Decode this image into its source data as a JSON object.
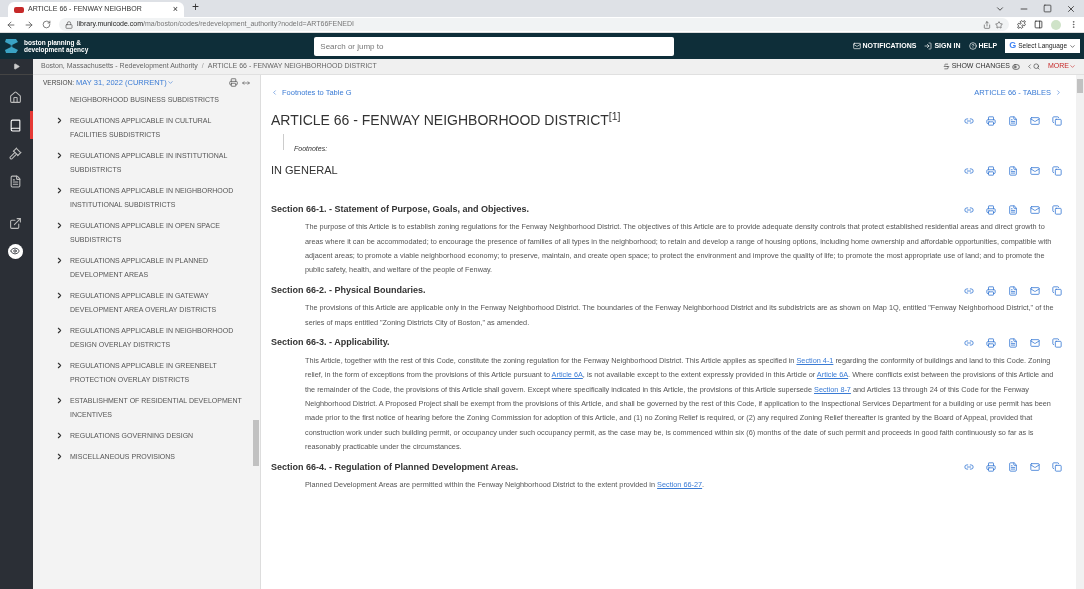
{
  "browser": {
    "tab_title": "ARTICLE 66 - FENWAY NEIGHBOR",
    "tab_close": "×",
    "new_tab": "+",
    "url_host": "library.municode.com",
    "url_path": "/ma/boston/codes/redevelopment_authority?nodeId=ART66FENEDI"
  },
  "header": {
    "logo_line1": "boston planning &",
    "logo_line2": "development agency",
    "search": {
      "placeholder": "Search or jump to"
    },
    "links": [
      "NOTIFICATIONS",
      "SIGN IN",
      "HELP"
    ],
    "language": "Select Language",
    "language_mark": "G"
  },
  "rail": {
    "items": [
      {
        "kind": "home",
        "selected": false
      },
      {
        "kind": "book",
        "selected": true
      },
      {
        "kind": "gavel",
        "selected": false
      },
      {
        "kind": "file",
        "selected": false
      },
      {
        "kind": "external",
        "selected": false
      },
      {
        "kind": "eye",
        "selected": false
      }
    ]
  },
  "breadcrumb": {
    "items": [
      "Boston, Massachusetts - Redevelopment Authority",
      "ARTICLE 66 - FENWAY NEIGHBORHOOD DISTRICT"
    ],
    "separator": "/",
    "show_changes": "SHOW CHANGES",
    "more": "MORE"
  },
  "toc": {
    "version_label": "VERSION:",
    "version": "MAY 31, 2022 (CURRENT)",
    "items": [
      {
        "kind": "continuation",
        "text": "NEIGHBORHOOD BUSINESS SUBDISTRICTS"
      },
      {
        "kind": "item",
        "text": "REGULATIONS APPLICABLE IN CULTURAL FACILITIES SUBDISTRICTS"
      },
      {
        "kind": "item",
        "text": "REGULATIONS APPLICABLE IN INSTITUTIONAL SUBDISTRICTS"
      },
      {
        "kind": "item",
        "text": "REGULATIONS APPLICABLE IN NEIGHBORHOOD INSTITUTIONAL SUBDISTRICTS"
      },
      {
        "kind": "item",
        "text": "REGULATIONS APPLICABLE IN OPEN SPACE SUBDISTRICTS"
      },
      {
        "kind": "item",
        "text": "REGULATIONS APPLICABLE IN PLANNED DEVELOPMENT AREAS"
      },
      {
        "kind": "item",
        "text": "REGULATIONS APPLICABLE IN GATEWAY DEVELOPMENT AREA OVERLAY DISTRICTS"
      },
      {
        "kind": "item",
        "text": "REGULATIONS APPLICABLE IN NEIGHBORHOOD DESIGN OVERLAY DISTRICTS"
      },
      {
        "kind": "item",
        "text": "REGULATIONS APPLICABLE IN GREENBELT PROTECTION OVERLAY DISTRICTS"
      },
      {
        "kind": "item",
        "text": "ESTABLISHMENT OF RESIDENTIAL DEVELOPMENT INCENTIVES"
      },
      {
        "kind": "item",
        "text": "REGULATIONS GOVERNING DESIGN"
      },
      {
        "kind": "item",
        "text": "MISCELLANEOUS PROVISIONS"
      }
    ]
  },
  "document": {
    "prev": "Footnotes to Table G",
    "next": "ARTICLE 66 - TABLES",
    "title": "ARTICLE 66 - FENWAY NEIGHBORHOOD DISTRICT$^{[1]}$",
    "footnotes_label": "Footnotes:",
    "sections": [
      {
        "kind": "heading",
        "title": "IN GENERAL"
      },
      {
        "kind": "section",
        "title": "Section 66-1. - Statement of Purpose, Goals, and Objectives.",
        "body": [
          {
            "kind": "text",
            "text": "The purpose of this Article is to establish zoning regulations for the Fenway Neighborhood District. The objectives of this Article are to provide adequate density controls that protect established residential areas and direct growth to areas where it can be accommodated; to encourage the presence of families of all types in the neighborhood; to retain and develop a range of housing options, including home ownership and affordable opportunities, compatible with adjacent areas; to promote a viable neighborhood economy; to preserve, maintain, and create open space; to protect the environment and improve the quality of life; to promote the most appropriate use of land; and to promote the public safety, health, and welfare of the people of Fenway."
          }
        ]
      },
      {
        "kind": "section",
        "title": "Section 66-2. - Physical Boundaries.",
        "body": [
          {
            "kind": "text",
            "text": "The provisions of this Article are applicable only in the Fenway Neighborhood District. The boundaries of the Fenway Neighborhood District and its subdistricts are as shown on Map 1Q, entitled \"Fenway Neighborhood District,\" of the series of maps entitled \"Zoning Districts City of Boston,\" as amended."
          }
        ]
      },
      {
        "kind": "section",
        "title": "Section 66-3. - Applicability.",
        "body": [
          {
            "kind": "text",
            "text": "This Article, together with the rest of this Code, constitute the zoning regulation for the Fenway Neighborhood District. This Article applies as specified in "
          },
          {
            "kind": "link",
            "text": "Section 4-1"
          },
          {
            "kind": "text",
            "text": " regarding the conformity of buildings and land to this Code. Zoning relief, in the form of exceptions from the provisions of this Article pursuant to "
          },
          {
            "kind": "link",
            "text": "Article 6A"
          },
          {
            "kind": "text",
            "text": ", is not available except to the extent expressly provided in this Article or "
          },
          {
            "kind": "link",
            "text": "Article 6A"
          },
          {
            "kind": "text",
            "text": ". Where conflicts exist between the provisions of this Article and the remainder of the Code, the provisions of this Article shall govern. Except where specifically indicated in this Article, the provisions of this Article supersede "
          },
          {
            "kind": "link",
            "text": "Section 8-7"
          },
          {
            "kind": "text",
            "text": " and Articles 13 through 24 of this Code for the Fenway Neighborhood District. A Proposed Project shall be exempt from the provisions of this Article, and shall be governed by the rest of this Code, if application to the Inspectional Services Department for a building or use permit has been made prior to the first notice of hearing before the Zoning Commission for adoption of this Article, and (1) no Zoning Relief is required, or (2) any required Zoning Relief thereafter is granted by the Board of Appeal, provided that construction work under such building permit, or occupancy under such occupancy permit, as the case may be, is commenced within six (6) months of the date of such permit and proceeds in good faith continuously so far as is reasonably practicable under the circumstances."
          }
        ]
      },
      {
        "kind": "section",
        "title": "Section 66-4. - Regulation of Planned Development Areas.",
        "body": [
          {
            "kind": "text",
            "text": "Planned Development Areas are permitted within the Fenway Neighborhood District to the extent provided in "
          },
          {
            "kind": "link",
            "text": "Section 66-27"
          },
          {
            "kind": "text",
            "text": "."
          }
        ]
      }
    ]
  }
}
